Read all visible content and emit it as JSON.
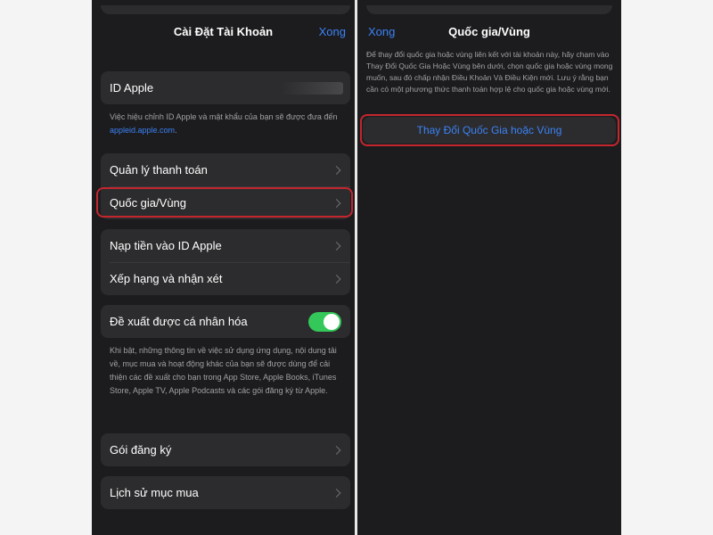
{
  "left": {
    "title": "Cài Đặt Tài Khoản",
    "done_label": "Xong",
    "apple_id": {
      "label": "ID Apple"
    },
    "apple_id_note": {
      "text": "Việc hiệu chỉnh ID Apple và mật khẩu của bạn sẽ được đưa đến ",
      "link": "appleid.apple.com",
      "end": "."
    },
    "group1": [
      {
        "label": "Quản lý thanh toán"
      },
      {
        "label": "Quốc gia/Vùng"
      }
    ],
    "group2": [
      {
        "label": "Nạp tiền vào ID Apple"
      },
      {
        "label": "Xếp hạng và nhận xét"
      }
    ],
    "personalized": {
      "label": "Đề xuất được cá nhân hóa",
      "enabled": true,
      "note": "Khi bật, những thông tin về việc sử dụng ứng dụng, nội dung tải về, mục mua và hoạt động khác của bạn sẽ được dùng để cải thiện các đề xuất cho bạn trong App Store, Apple Books, iTunes Store, Apple TV, Apple Podcasts và các gói đăng ký từ Apple."
    },
    "subscriptions": {
      "label": "Gói đăng ký"
    },
    "purchase_history": {
      "label": "Lịch sử mục mua"
    }
  },
  "right": {
    "done_label": "Xong",
    "title": "Quốc gia/Vùng",
    "description": "Để thay đổi quốc gia hoặc vùng liên kết với tài khoản này, hãy chạm vào Thay Đổi Quốc Gia Hoặc Vùng bên dưới, chọn quốc gia hoặc vùng mong muốn, sau đó chấp nhận Điều Khoản Và Điều Kiện mới. Lưu ý rằng bạn cần có một phương thức thanh toán hợp lệ cho quốc gia hoặc vùng mới.",
    "change_button": "Thay Đổi Quốc Gia hoặc Vùng"
  },
  "colors": {
    "background": "#1c1c1e",
    "cell": "#2c2c2e",
    "accent": "#3b82f6",
    "toggle_on": "#34c759",
    "highlight": "#c4262e"
  }
}
